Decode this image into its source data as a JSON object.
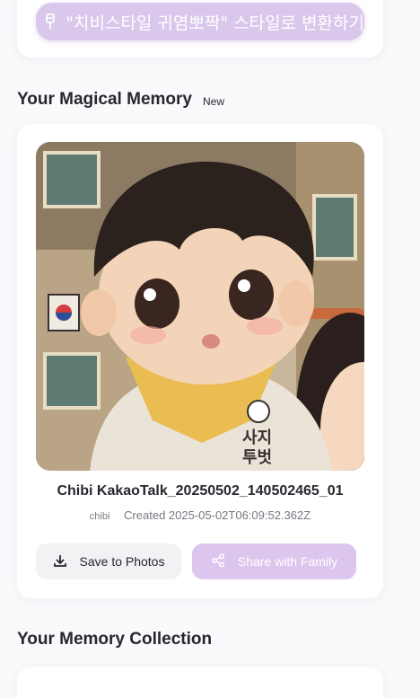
{
  "convert_button": {
    "label": "\"치비스타일 귀염뽀짝\" 스타일로 변환하기",
    "icon": "sparkle-icon"
  },
  "memory_section": {
    "title": "Your Magical Memory",
    "badge": "New"
  },
  "memory": {
    "title": "Chibi KakaoTalk_20250502_140502465_01",
    "tag": "chibi",
    "created": "Created 2025-05-02T06:09:52.362Z",
    "image_alt": "chibi illustration of a child",
    "scarf_text": "사지\n투벗"
  },
  "actions": {
    "save_label": "Save to Photos",
    "share_label": "Share with Family"
  },
  "collection_section": {
    "title": "Your Memory Collection"
  },
  "colors": {
    "accent": "#d9c8ec",
    "text": "#2a2630",
    "muted": "#7a7680"
  }
}
